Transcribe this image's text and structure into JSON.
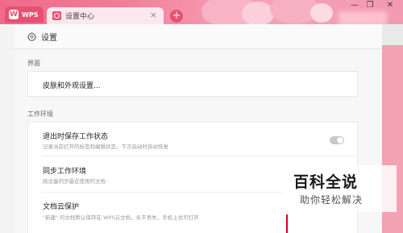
{
  "window": {
    "app_tab_label": "WPS",
    "app_logo_letter": "W",
    "active_tab_title": "设置中心",
    "close_glyph": "×",
    "add_glyph": "+",
    "controls": [
      "—",
      "❐",
      "✕"
    ]
  },
  "header": {
    "title": "设置"
  },
  "sections": {
    "interface": {
      "label": "界面",
      "skin_row_title": "皮肤和外观设置..."
    },
    "work_env": {
      "label": "工作环境",
      "rows": [
        {
          "title": "退出时保存工作状态",
          "desc": "记录当前打开的标签和编辑状态，下次启动时自动恢复"
        },
        {
          "title": "同步工作环境",
          "desc": "跨设备同步最近使用的文档"
        },
        {
          "title": "文档云保护",
          "desc": "\"新建\" 的文档默认保存在 WPS云文档，永不丢失，手机上也可打开"
        }
      ]
    }
  },
  "watermark": {
    "main": "百科全说",
    "sub": "助你轻松解决"
  },
  "colors": {
    "accent": "#e8506f",
    "titlebar": "#f27c97"
  }
}
